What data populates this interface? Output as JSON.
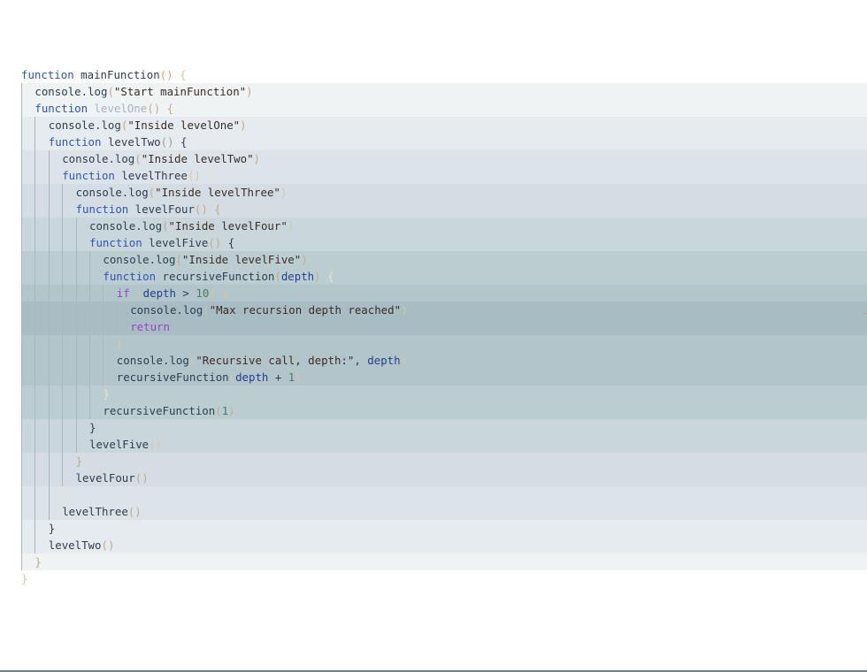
{
  "editor": {
    "language": "javascript",
    "indent_guides": true,
    "rainbow_indent_backgrounds": true,
    "lines": [
      {
        "indent": 0,
        "tokens": [
          [
            "kw",
            "function"
          ],
          [
            "pl",
            " "
          ],
          [
            "fn",
            "mainFunction"
          ],
          [
            "p2",
            "()"
          ],
          [
            "pl",
            " "
          ],
          [
            "p3",
            "{"
          ]
        ]
      },
      {
        "indent": 1,
        "tokens": [
          [
            "pl",
            "console.log"
          ],
          [
            "p2",
            "("
          ],
          [
            "str",
            "\"Start mainFunction\""
          ],
          [
            "p2",
            ")"
          ]
        ]
      },
      {
        "indent": 1,
        "tokens": [
          [
            "kw",
            "function"
          ],
          [
            "pl",
            " "
          ],
          [
            "dim",
            "levelOne"
          ],
          [
            "p2",
            "()"
          ],
          [
            "pl",
            " "
          ],
          [
            "p2",
            "{"
          ]
        ]
      },
      {
        "indent": 2,
        "tokens": [
          [
            "pl",
            "console.log"
          ],
          [
            "p2",
            "("
          ],
          [
            "str",
            "\"Inside levelOne\""
          ],
          [
            "p2",
            ")"
          ]
        ]
      },
      {
        "indent": 2,
        "tokens": [
          [
            "kw",
            "function"
          ],
          [
            "pl",
            " "
          ],
          [
            "fn",
            "levelTwo"
          ],
          [
            "p1",
            "()"
          ],
          [
            "pl",
            " "
          ],
          [
            "pl",
            "{"
          ]
        ]
      },
      {
        "indent": 3,
        "tokens": [
          [
            "pl",
            "console.log"
          ],
          [
            "p2",
            "("
          ],
          [
            "str",
            "\"Inside levelTwo\""
          ],
          [
            "p2",
            ")"
          ]
        ]
      },
      {
        "indent": 3,
        "tokens": [
          [
            "kw",
            "function"
          ],
          [
            "pl",
            " "
          ],
          [
            "fn",
            "levelThree"
          ],
          [
            "p3",
            "()"
          ],
          [
            "pl",
            " "
          ],
          [
            "p4",
            "{"
          ]
        ]
      },
      {
        "indent": 4,
        "tokens": [
          [
            "pl",
            "console.log"
          ],
          [
            "p2",
            "("
          ],
          [
            "str",
            "\"Inside levelThree\""
          ],
          [
            "p3",
            ")"
          ]
        ]
      },
      {
        "indent": 4,
        "tokens": [
          [
            "kw",
            "function"
          ],
          [
            "pl",
            " "
          ],
          [
            "fn",
            "levelFour"
          ],
          [
            "p2",
            "()"
          ],
          [
            "pl",
            " "
          ],
          [
            "p2",
            "{"
          ]
        ]
      },
      {
        "indent": 5,
        "tokens": [
          [
            "pl",
            "console.log"
          ],
          [
            "p2",
            "("
          ],
          [
            "str",
            "\"Inside levelFour\""
          ],
          [
            "p3",
            ")"
          ]
        ]
      },
      {
        "indent": 5,
        "tokens": [
          [
            "kw",
            "function"
          ],
          [
            "pl",
            " "
          ],
          [
            "fn",
            "levelFive"
          ],
          [
            "p2",
            "()"
          ],
          [
            "pl",
            " "
          ],
          [
            "pl",
            "{"
          ]
        ]
      },
      {
        "indent": 6,
        "tokens": [
          [
            "pl",
            "console.log"
          ],
          [
            "p2",
            "("
          ],
          [
            "str",
            "\"Inside levelFive\""
          ],
          [
            "p2",
            ")"
          ]
        ]
      },
      {
        "indent": 6,
        "tokens": [
          [
            "kw",
            "function"
          ],
          [
            "pl",
            " "
          ],
          [
            "fn",
            "recursiveFunction"
          ],
          [
            "p2",
            "("
          ],
          [
            "var",
            "depth"
          ],
          [
            "p2",
            ")"
          ],
          [
            "pl",
            " "
          ],
          [
            "p4",
            "{"
          ]
        ]
      },
      {
        "indent": 7,
        "tokens": [
          [
            "ret",
            "if"
          ],
          [
            "pl",
            " "
          ],
          [
            "p3",
            "("
          ],
          [
            "var",
            "depth"
          ],
          [
            "pl",
            " > "
          ],
          [
            "num",
            "10"
          ],
          [
            "p3",
            ")"
          ],
          [
            "pl",
            " "
          ],
          [
            "p3",
            "{"
          ]
        ]
      },
      {
        "indent": 8,
        "tokens": [
          [
            "pl",
            "console.log"
          ],
          [
            "p3",
            "("
          ],
          [
            "str",
            "\"Max recursion depth reached\""
          ],
          [
            "p3",
            ")"
          ]
        ]
      },
      {
        "indent": 8,
        "tokens": [
          [
            "ret",
            "return"
          ]
        ]
      },
      {
        "indent": 7,
        "tokens": [
          [
            "p3",
            "}"
          ]
        ]
      },
      {
        "indent": 7,
        "tokens": [
          [
            "pl",
            "console.log"
          ],
          [
            "p3",
            "("
          ],
          [
            "str",
            "\"Recursive call, depth:\""
          ],
          [
            "pl",
            ", "
          ],
          [
            "var",
            "depth"
          ],
          [
            "p3",
            ")"
          ]
        ]
      },
      {
        "indent": 7,
        "tokens": [
          [
            "fn",
            "recursiveFunction"
          ],
          [
            "p3",
            "("
          ],
          [
            "var",
            "depth"
          ],
          [
            "pl",
            " + "
          ],
          [
            "num",
            "1"
          ],
          [
            "p3",
            ")"
          ]
        ]
      },
      {
        "indent": 6,
        "tokens": [
          [
            "p4",
            "}"
          ]
        ]
      },
      {
        "indent": 6,
        "tokens": [
          [
            "fn",
            "recursiveFunction"
          ],
          [
            "p2",
            "("
          ],
          [
            "num",
            "1"
          ],
          [
            "p2",
            ")"
          ]
        ]
      },
      {
        "indent": 5,
        "tokens": [
          [
            "pl",
            "}"
          ]
        ]
      },
      {
        "indent": 5,
        "tokens": [
          [
            "fn",
            "levelFive"
          ],
          [
            "p3",
            "()"
          ]
        ]
      },
      {
        "indent": 4,
        "tokens": [
          [
            "p2",
            "}"
          ]
        ]
      },
      {
        "indent": 4,
        "tokens": [
          [
            "fn",
            "levelFour"
          ],
          [
            "p2",
            "()"
          ]
        ]
      },
      {
        "indent": 3,
        "tokens": [
          [
            "p4",
            "}"
          ]
        ]
      },
      {
        "indent": 3,
        "tokens": [
          [
            "fn",
            "levelThree"
          ],
          [
            "p2",
            "()"
          ]
        ]
      },
      {
        "indent": 2,
        "tokens": [
          [
            "pl",
            "}"
          ]
        ]
      },
      {
        "indent": 2,
        "tokens": [
          [
            "fn",
            "levelTwo"
          ],
          [
            "p2",
            "()"
          ]
        ]
      },
      {
        "indent": 1,
        "tokens": [
          [
            "p2",
            "}"
          ]
        ]
      },
      {
        "indent": 0,
        "tokens": [
          [
            "p3",
            "}"
          ]
        ]
      }
    ]
  },
  "colors": {
    "band_by_depth": [
      "#ffffff",
      "#eff3f4",
      "#e5ebee",
      "#dce4e9",
      "#d3dde3",
      "#c9d7dd",
      "#bccdd2",
      "#b1c5ca",
      "#a8bcc3"
    ],
    "guide": "#a9b7bf",
    "keyword": "#2f55b3",
    "string": "#3e2b25",
    "bracket": "#c7a982"
  }
}
